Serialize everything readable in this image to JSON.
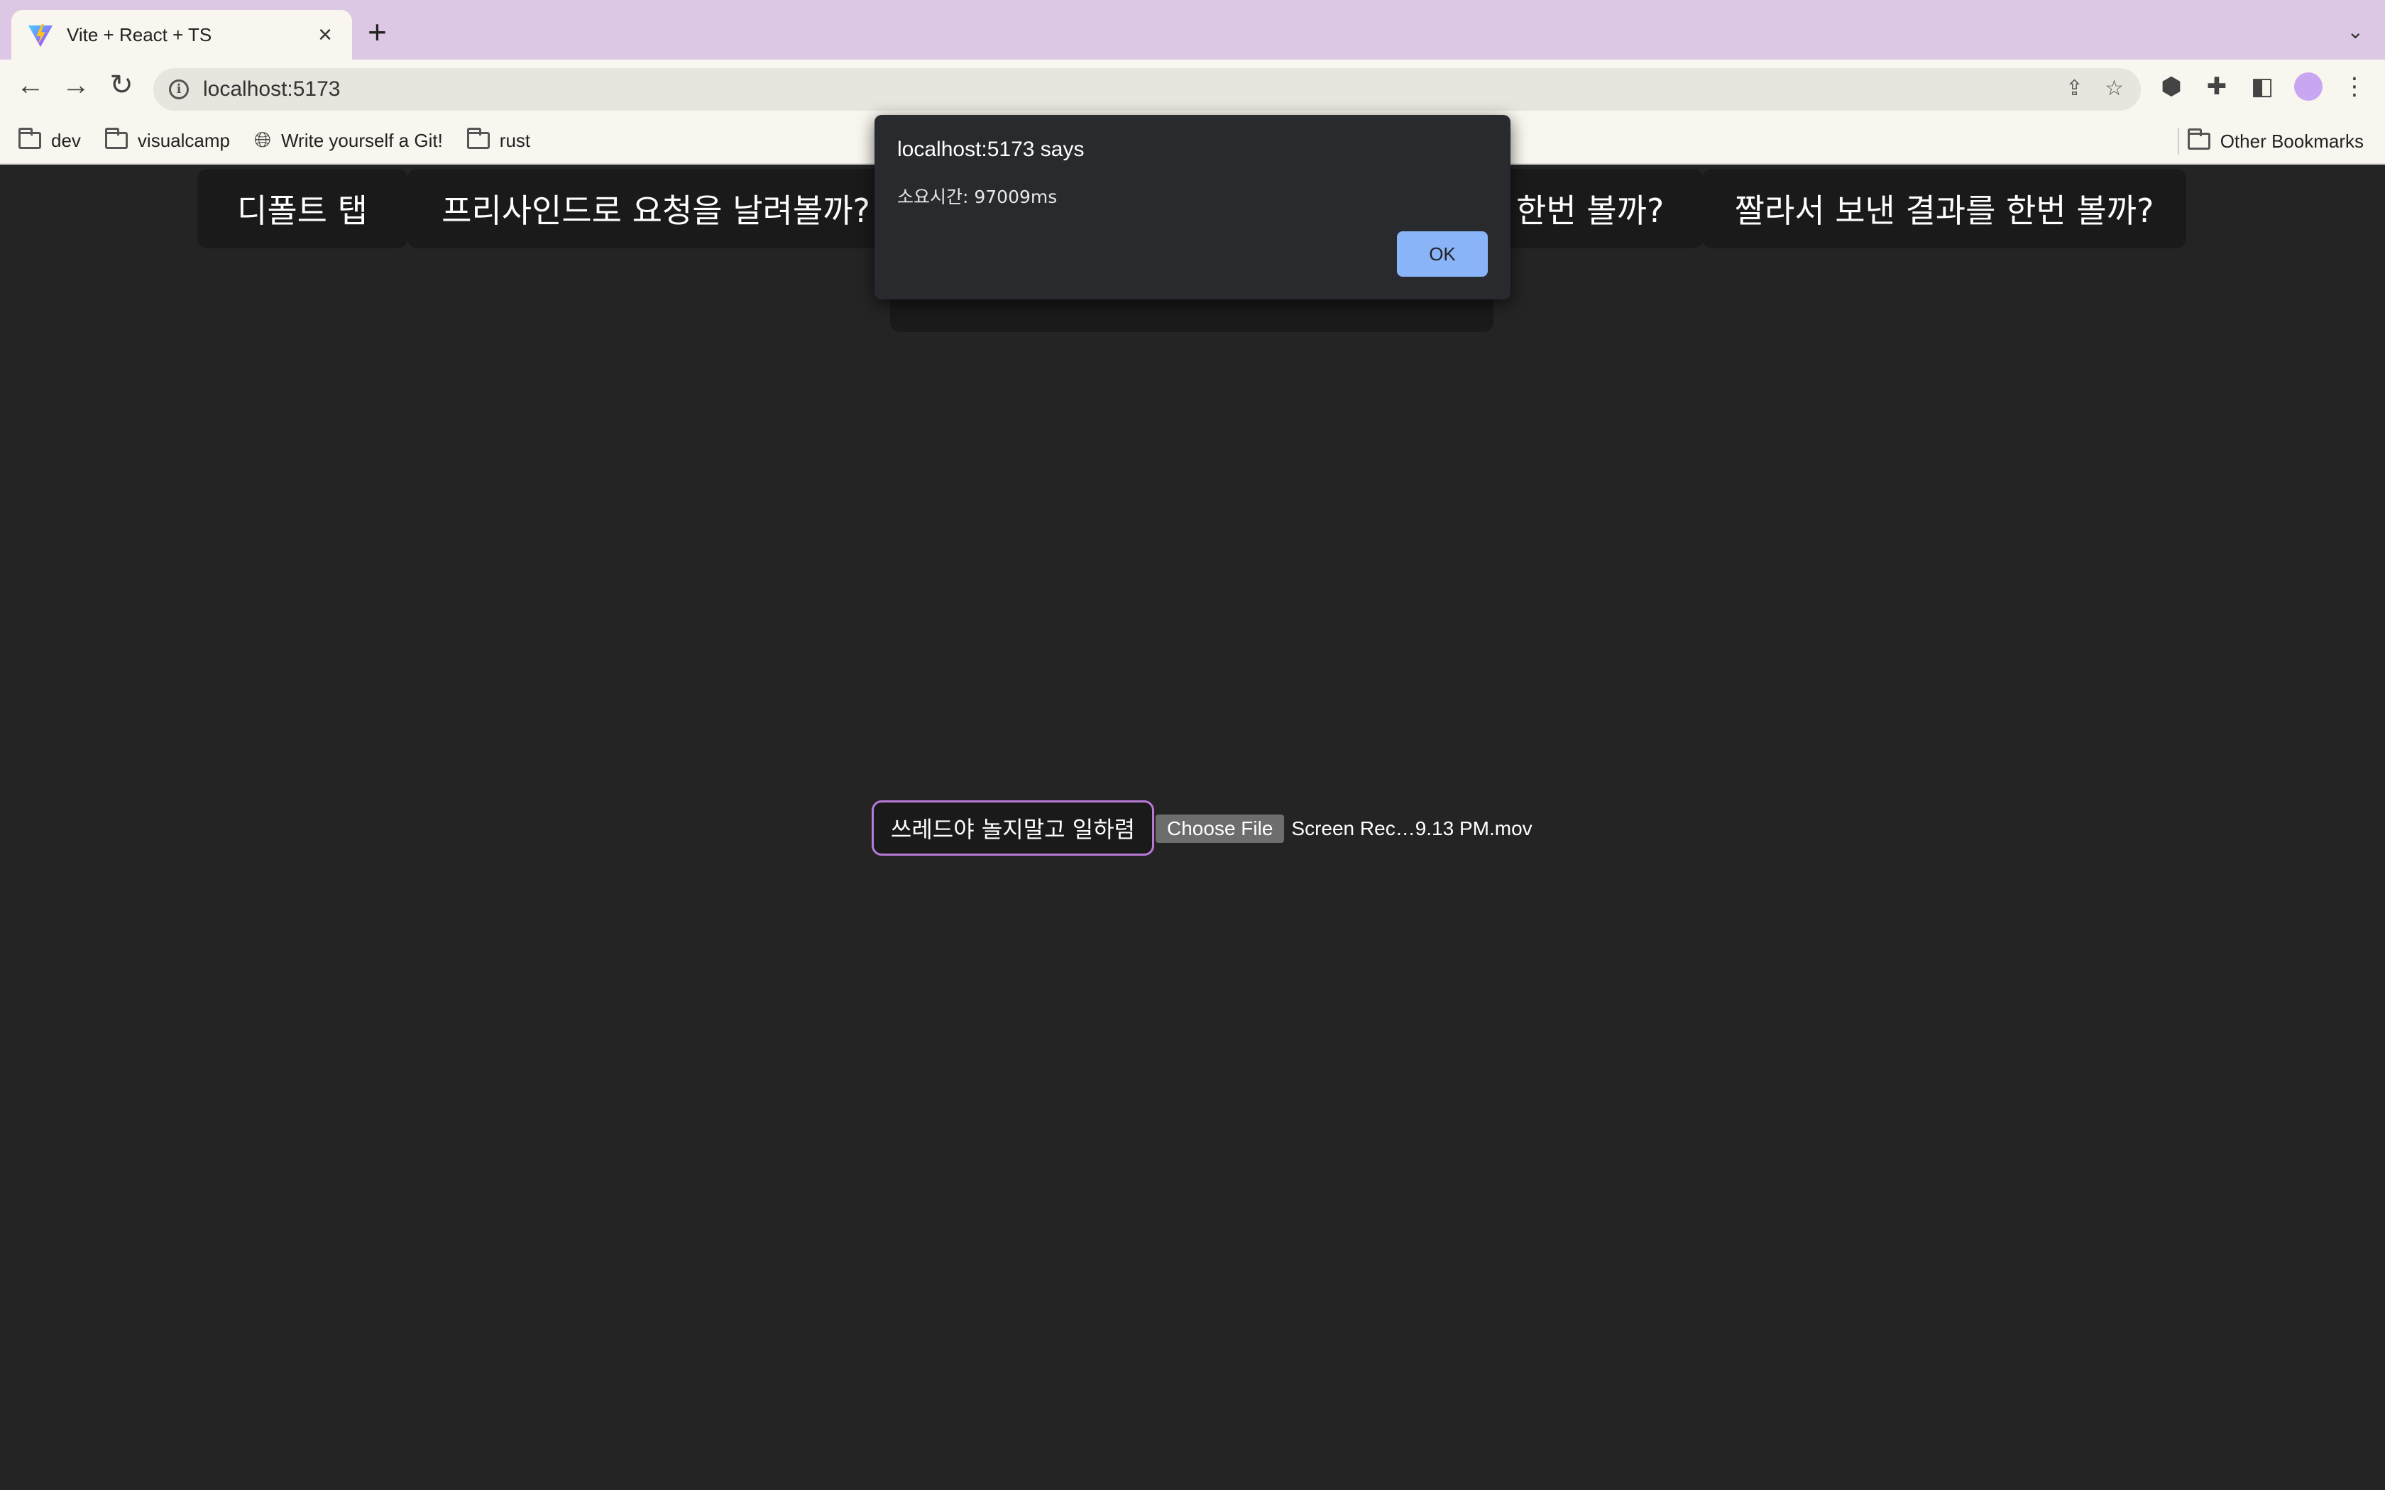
{
  "browser": {
    "tab_title": "Vite + React + TS",
    "new_tab": "+",
    "url": "localhost:5173",
    "bookmarks": [
      {
        "label": "dev",
        "icon": "folder-icon"
      },
      {
        "label": "visualcamp",
        "icon": "folder-icon"
      },
      {
        "label": "Write yourself a Git!",
        "icon": "globe-icon"
      },
      {
        "label": "rust",
        "icon": "folder-icon"
      }
    ],
    "other_bookmarks": "Other Bookmarks"
  },
  "page": {
    "tabs": [
      {
        "label": "디폴트 탭"
      },
      {
        "label": "프리사인드로 요청을 날려볼까?"
      },
      {
        "label": "한번 볼까?"
      },
      {
        "label": "짤라서 보낸 결과를 한번 볼까?"
      }
    ],
    "worker_button": "쓰레드야 놀지말고 일하렴",
    "choose_file": "Choose File",
    "file_name": "Screen Rec…9.13 PM.mov"
  },
  "dialog": {
    "title": "localhost:5173 says",
    "message": "소요시간: 97009ms",
    "ok": "OK"
  },
  "colors": {
    "tabstrip": "#dcc8e4",
    "page_bg": "#242424",
    "button_bg": "#1a1a1a",
    "accent_border": "#b87ad8",
    "dialog_ok": "#8ab4f8"
  }
}
